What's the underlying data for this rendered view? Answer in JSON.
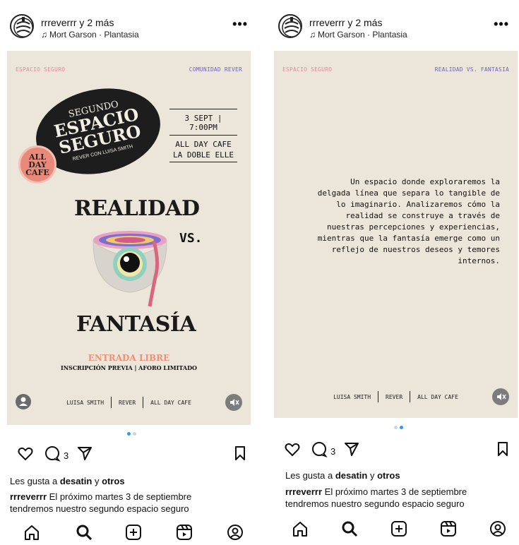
{
  "posts": [
    {
      "header": {
        "user": "rrreverrr y 2 más",
        "song": "Mort Garson · Plantasia",
        "more": "•••"
      },
      "slide": {
        "corner_left": "ESPACIO SEGURO",
        "corner_right": "COMUNIDAD REVER",
        "oval_small": "SEGUNDO",
        "oval_big": "ESPACIO SEGURO",
        "oval_sub": "REVER CON LUISA SMITH",
        "badge": "ALL DAY CAFE",
        "date_time": "3 SEPT | 7:00PM",
        "venue_1": "ALL DAY CAFE",
        "venue_2": "LA DOBLE ELLE",
        "title_1": "REALIDAD",
        "vs": "VS.",
        "title_2": "FANTASÍA",
        "entrada": "ENTRADA LIBRE",
        "inscripcion": "INSCRIPCIÓN PREVIA | AFORO LIMITADO",
        "credits": [
          "LUISA SMITH",
          "REVER",
          "ALL DAY CAFE"
        ]
      },
      "comments_count": "3",
      "likes_prefix": "Les gusta a ",
      "likes_user": "desatin",
      "likes_mid": " y ",
      "likes_others": "otros",
      "caption_user": "rrreverrr",
      "caption_text": " El próximo martes 3 de septiembre tendremos nuestro segundo espacio seguro"
    },
    {
      "header": {
        "user": "rrreverrr y 2 más",
        "song": "Mort Garson · Plantasia",
        "more": "•••"
      },
      "slide": {
        "corner_left": "ESPACIO SEGURO",
        "corner_right": "REALIDAD VS. FANTASIA",
        "paragraph": "Un espacio donde exploraremos la delgada línea que separa lo tangible de lo imaginario. Analizaremos cómo la realidad se construye a través de nuestras percepciones y experiencias, mientras que la fantasía emerge como un reflejo de nuestros deseos y temores internos.",
        "credits": [
          "LUISA SMITH",
          "REVER",
          "ALL DAY CAFE"
        ]
      },
      "comments_count": "3",
      "likes_prefix": "Les gusta a ",
      "likes_user": "desatin",
      "likes_mid": " y ",
      "likes_others": "otros",
      "caption_user": "rrreverrr",
      "caption_text": " El próximo martes 3 de septiembre tendremos nuestro segundo espacio seguro"
    }
  ],
  "colors": {
    "accent_blue": "#3897f0",
    "cream": "#ece6da",
    "coral": "#e99378"
  },
  "icons": [
    "heart-icon",
    "comment-icon",
    "share-icon",
    "bookmark-icon",
    "home-icon",
    "search-icon",
    "create-icon",
    "reels-icon",
    "profile-icon",
    "music-note-icon",
    "mute-icon"
  ]
}
